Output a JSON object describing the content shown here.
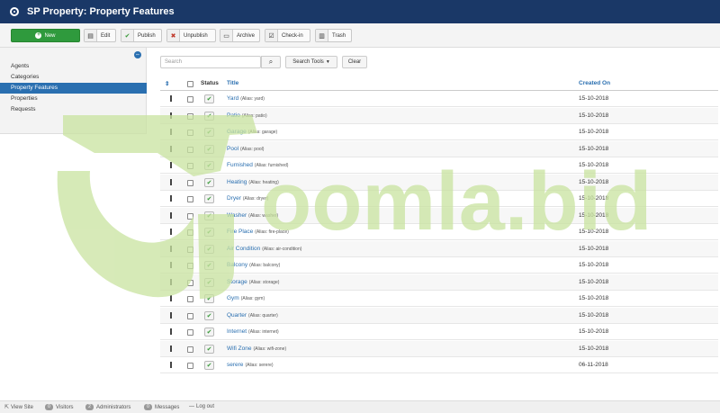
{
  "header": {
    "title": "SP Property: Property Features"
  },
  "toolbar": {
    "new_label": "New",
    "edit_label": "Edit",
    "publish_label": "Publish",
    "unpublish_label": "Unpublish",
    "archive_label": "Archive",
    "checkin_label": "Check-in",
    "trash_label": "Trash"
  },
  "sidebar": {
    "items": [
      {
        "label": "Agents"
      },
      {
        "label": "Categories"
      },
      {
        "label": "Property Features"
      },
      {
        "label": "Properties"
      },
      {
        "label": "Requests"
      }
    ]
  },
  "filters": {
    "search_placeholder": "Search",
    "search_tools_label": "Search Tools",
    "clear_label": "Clear"
  },
  "table": {
    "headers": {
      "ordering": "⇕",
      "status": "Status",
      "title": "Title",
      "created": "Created On"
    },
    "rows": [
      {
        "title": "Yard",
        "alias": "(Alias: yard)",
        "created": "15-10-2018"
      },
      {
        "title": "Patio",
        "alias": "(Alias: patio)",
        "created": "15-10-2018"
      },
      {
        "title": "Garage",
        "alias": "(Alias: garage)",
        "created": "15-10-2018"
      },
      {
        "title": "Pool",
        "alias": "(Alias: pool)",
        "created": "15-10-2018"
      },
      {
        "title": "Furnished",
        "alias": "(Alias: furnished)",
        "created": "15-10-2018"
      },
      {
        "title": "Heating",
        "alias": "(Alias: heating)",
        "created": "15-10-2018"
      },
      {
        "title": "Dryer",
        "alias": "(Alias: dryer)",
        "created": "15-10-2018"
      },
      {
        "title": "Washer",
        "alias": "(Alias: washer)",
        "created": "15-10-2018"
      },
      {
        "title": "Fire Place",
        "alias": "(Alias: fire-place)",
        "created": "15-10-2018"
      },
      {
        "title": "Air Condition",
        "alias": "(Alias: air-condition)",
        "created": "15-10-2018"
      },
      {
        "title": "Balcony",
        "alias": "(Alias: balcony)",
        "created": "15-10-2018"
      },
      {
        "title": "Storage",
        "alias": "(Alias: storage)",
        "created": "15-10-2018"
      },
      {
        "title": "Gym",
        "alias": "(Alias: gym)",
        "created": "15-10-2018"
      },
      {
        "title": "Quarter",
        "alias": "(Alias: quarter)",
        "created": "15-10-2018"
      },
      {
        "title": "Internet",
        "alias": "(Alias: internet)",
        "created": "15-10-2018"
      },
      {
        "title": "Wifi Zone",
        "alias": "(Alias: wifi-zone)",
        "created": "15-10-2018"
      },
      {
        "title": "serere",
        "alias": "(Alias: serere)",
        "created": "06-11-2018"
      }
    ]
  },
  "footer": {
    "view_site": "View Site",
    "visitors_count": "0",
    "visitors_label": "Visitors",
    "admins_count": "2",
    "admins_label": "Administrators",
    "messages_count": "0",
    "messages_label": "Messages",
    "logout_label": "Log out"
  },
  "watermark": {
    "text": "oomla.bid"
  },
  "colors": {
    "header": "#1a3867",
    "new_button": "#2f9a3d",
    "active_item": "#2a6fb0",
    "link": "#2a6fb0",
    "watermark": "#c9e3a0"
  }
}
